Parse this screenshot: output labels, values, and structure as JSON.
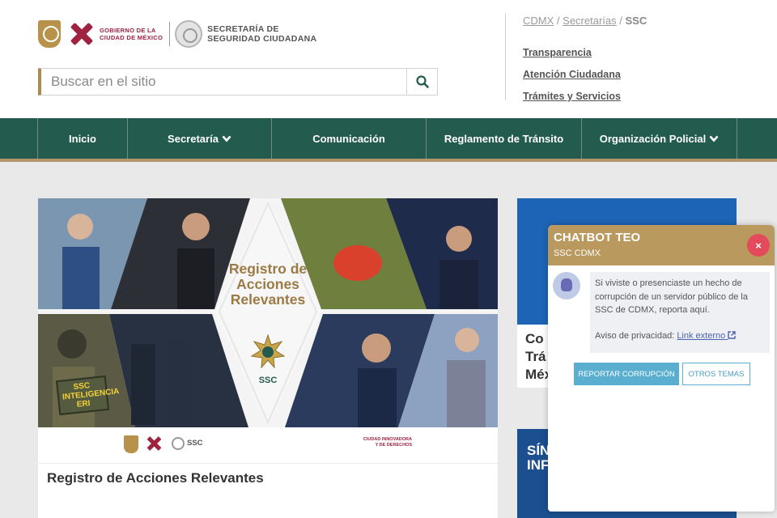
{
  "header": {
    "gobierno_line1": "GOBIERNO DE LA",
    "gobierno_line2": "CIUDAD DE MÉXICO",
    "ssc_line1": "SECRETARÍA DE",
    "ssc_line2": "SEGURIDAD CIUDADANA"
  },
  "search": {
    "placeholder": "Buscar en el sitio",
    "icon": "search-icon"
  },
  "breadcrumb": {
    "items": [
      "CDMX",
      "Secretarías"
    ],
    "separator": "/",
    "current": "SSC"
  },
  "quick_links": [
    "Transparencia",
    "Atención Ciudadana",
    "Trámites y Servicios"
  ],
  "nav": {
    "items": [
      {
        "label": "Inicio",
        "has_dropdown": false
      },
      {
        "label": "Secretaría",
        "has_dropdown": true
      },
      {
        "label": "Comunicación",
        "has_dropdown": false
      },
      {
        "label": "Reglamento de Tránsito",
        "has_dropdown": false
      },
      {
        "label": "Organización Policial",
        "has_dropdown": true
      }
    ]
  },
  "main_card": {
    "banner_title": "Registro de Acciones Relevantes",
    "banner_badge_label": "SSC",
    "sticker_text": "SSC INTELIGENCIA ERI",
    "footer_ssc": "SSC",
    "footer_slogan": "CIUDAD INNOVADORA Y DE DERECHOS",
    "title": "Registro de Acciones Relevantes"
  },
  "side_card": {
    "text_lines": [
      "Co",
      "Trá",
      "Méx"
    ]
  },
  "side_card2": {
    "text_lines": [
      "SÍN",
      "INFO"
    ]
  },
  "chatbot": {
    "title": "CHATBOT TEO",
    "subtitle": "SSC CDMX",
    "close_label": "×",
    "message": "Si viviste o presenciaste un hecho de corrupción de un servidor público de la SSC de CDMX, reporta aquí.",
    "privacy_label": "Aviso de privacidad:",
    "privacy_link": "Link externo",
    "btn_report": "REPORTAR CORRUPCIÓN",
    "btn_other": "OTROS TEMAS"
  },
  "colors": {
    "nav_green": "#235b4e",
    "gold": "#b9995e",
    "cdmx_red": "#9f2241",
    "chat_blue": "#5aaed0",
    "close_red": "#e34b5d"
  }
}
